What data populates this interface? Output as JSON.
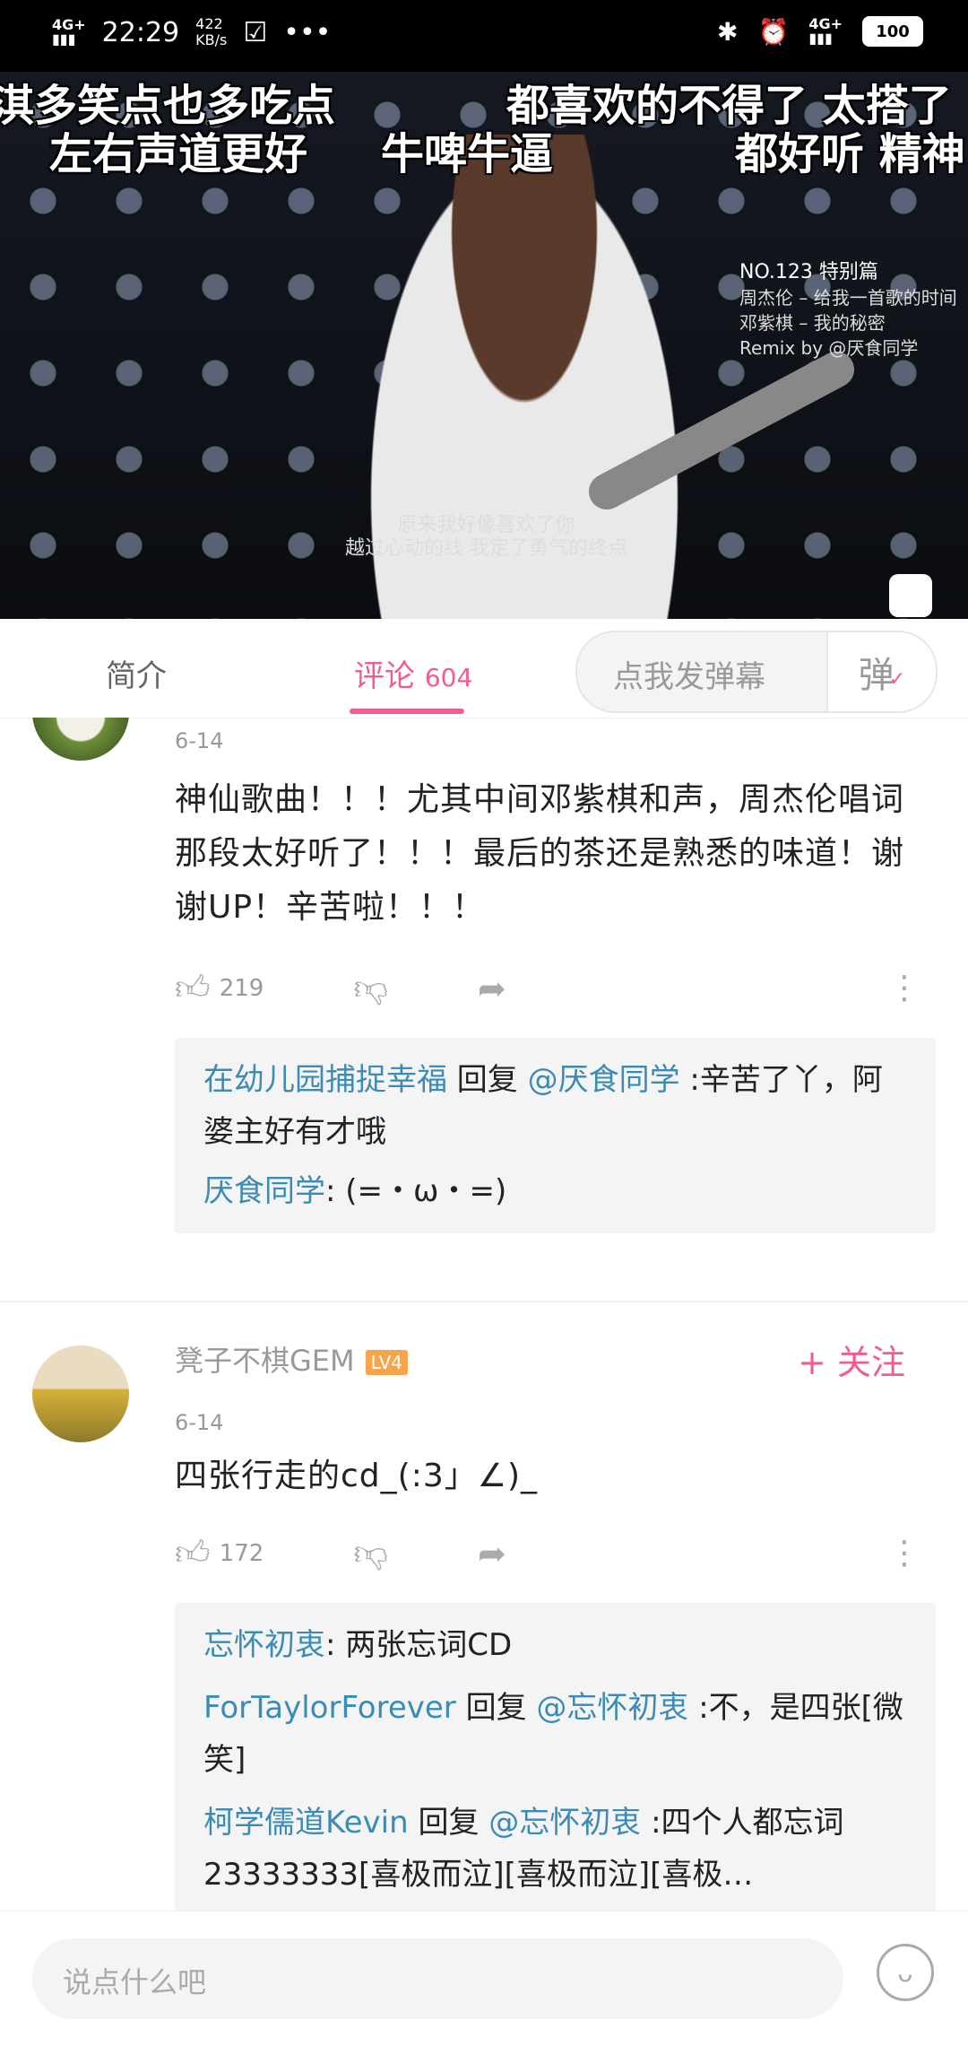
{
  "status_bar": {
    "network_left": "4G+",
    "time": "22:29",
    "speed_value": "422",
    "speed_unit": "KB/s",
    "more": "•••",
    "network_right": "4G+",
    "battery": "100"
  },
  "video": {
    "danmaku": [
      "淇多笑点也多吃点",
      "都喜欢的不得了 太搭了",
      "左右声道更好",
      "牛啤牛逼",
      "都好听 精神"
    ],
    "overlay_title": "NO.123 特别篇",
    "overlay_lines": [
      "周杰伦 – 给我一首歌的时间",
      "邓紫棋 – 我的秘密",
      "Remix by @厌食同学"
    ],
    "subtitle_top": "原来我好像喜欢了你",
    "subtitle_bottom": "越过心动的线 我定了勇气的终点"
  },
  "tabs": {
    "intro": "简介",
    "comments_label": "评论",
    "comments_count": "604",
    "danmaku_placeholder": "点我发弹幕",
    "danmaku_button": "弹"
  },
  "comments": [
    {
      "date": "6-14",
      "text": "神仙歌曲！！！尤其中间邓紫棋和声，周杰伦唱词那段太好听了！！！最后的茶还是熟悉的味道！谢谢UP！辛苦啦！！！",
      "likes": "219",
      "replies": [
        {
          "user": "在幼儿园捕捉幸福",
          "reply_word": " 回复 ",
          "at": "@厌食同学",
          "text": " :辛苦了丫，阿婆主好有才哦"
        },
        {
          "user": "厌食同学",
          "text": ": (=・ω・=)"
        }
      ]
    },
    {
      "username": "凳子不棋GEM",
      "level": "LV4",
      "follow": "+ 关注",
      "date": "6-14",
      "text": "四张行走的cd_(:3」∠)_",
      "likes": "172",
      "replies": [
        {
          "user": "忘怀初衷",
          "text": ": 两张忘词CD"
        },
        {
          "user": "ForTaylorForever",
          "reply_word": " 回复 ",
          "at": "@忘怀初衷",
          "text": " :不，是四张[微笑]"
        },
        {
          "user": "柯学儒道Kevin",
          "reply_word": " 回复 ",
          "at": "@忘怀初衷",
          "text": " :四个人都忘词23333333[喜极而泣][喜极而泣][喜极…"
        }
      ]
    }
  ],
  "bottom_bar": {
    "placeholder": "说点什么吧"
  },
  "colors": {
    "accent": "#f25d8e",
    "username": "#3a8bb5",
    "level_badge": "#f7a54a"
  }
}
